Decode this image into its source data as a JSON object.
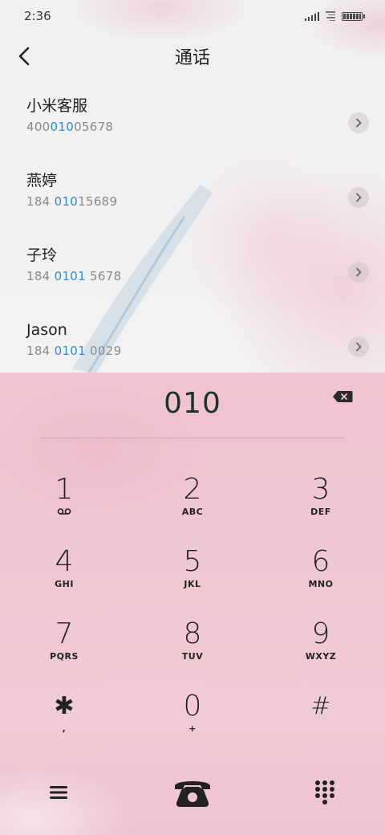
{
  "status_bar": {
    "time": "2:36"
  },
  "header": {
    "title": "通话"
  },
  "contacts": [
    {
      "name": "小米客服",
      "number_pre": "400",
      "number_match": "010",
      "number_post": "05678"
    },
    {
      "name": "燕婷",
      "number_pre": "184 ",
      "number_match": "010",
      "number_post": "15689"
    },
    {
      "name": "子玲",
      "number_pre": "184 ",
      "number_match": "0101",
      "number_post": " 5678"
    },
    {
      "name": "Jason",
      "number_pre": "184 ",
      "number_match": "0101",
      "number_post": " 0029"
    }
  ],
  "dialer": {
    "input": "010",
    "keys": [
      {
        "digit": "1",
        "letters": ""
      },
      {
        "digit": "2",
        "letters": "ABC"
      },
      {
        "digit": "3",
        "letters": "DEF"
      },
      {
        "digit": "4",
        "letters": "GHI"
      },
      {
        "digit": "5",
        "letters": "JKL"
      },
      {
        "digit": "6",
        "letters": "MNO"
      },
      {
        "digit": "7",
        "letters": "PQRS"
      },
      {
        "digit": "8",
        "letters": "TUV"
      },
      {
        "digit": "9",
        "letters": "WXYZ"
      },
      {
        "digit": "✱",
        "letters": ","
      },
      {
        "digit": "0",
        "letters": "+"
      },
      {
        "digit": "#",
        "letters": ""
      }
    ]
  },
  "icons": {
    "back": "back-arrow-icon",
    "chevron": "chevron-right-icon",
    "backspace": "backspace-icon",
    "voicemail": "voicemail-icon",
    "menu": "menu-icon",
    "call": "phone-call-icon",
    "keypad": "keypad-icon"
  },
  "colors": {
    "highlight": "#2b8fd6",
    "dialed_text": "#1c3328",
    "pink_background": "#efc5d0"
  }
}
